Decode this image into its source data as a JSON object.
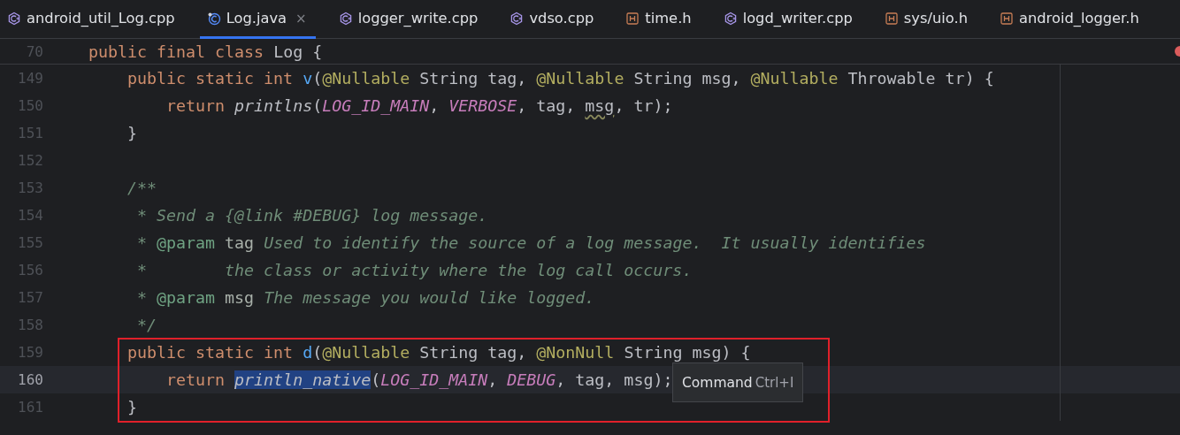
{
  "tabs": [
    {
      "label": "android_util_Log.cpp",
      "kind": "cpp",
      "selected": false
    },
    {
      "label": "Log.java",
      "kind": "java",
      "selected": true,
      "close": "×"
    },
    {
      "label": "logger_write.cpp",
      "kind": "cpp",
      "selected": false
    },
    {
      "label": "vdso.cpp",
      "kind": "cpp",
      "selected": false
    },
    {
      "label": "time.h",
      "kind": "header",
      "selected": false
    },
    {
      "label": "logd_writer.cpp",
      "kind": "cpp",
      "selected": false
    },
    {
      "label": "sys/uio.h",
      "kind": "header",
      "selected": false
    },
    {
      "label": "android_logger.h",
      "kind": "header",
      "selected": false
    }
  ],
  "sticky_line": {
    "number": "70",
    "has_error": true,
    "tokens": [
      {
        "kind": "kw",
        "text": "public final class "
      },
      {
        "kind": "plain",
        "text": "Log {"
      }
    ]
  },
  "lines": [
    {
      "number": "149",
      "current": false,
      "boxed": false,
      "tokens": [
        {
          "kind": "kw",
          "text": "    public static int "
        },
        {
          "kind": "fn",
          "text": "v"
        },
        {
          "kind": "plain",
          "text": "("
        },
        {
          "kind": "ann",
          "text": "@Nullable"
        },
        {
          "kind": "plain",
          "text": " String tag, "
        },
        {
          "kind": "ann",
          "text": "@Nullable"
        },
        {
          "kind": "plain",
          "text": " String msg, "
        },
        {
          "kind": "ann",
          "text": "@Nullable"
        },
        {
          "kind": "plain",
          "text": " Throwable tr) {"
        }
      ]
    },
    {
      "number": "150",
      "current": false,
      "boxed": false,
      "tokens": [
        {
          "kind": "kw",
          "text": "        return "
        },
        {
          "kind": "call",
          "text": "printlns"
        },
        {
          "kind": "plain",
          "text": "("
        },
        {
          "kind": "const",
          "text": "LOG_ID_MAIN"
        },
        {
          "kind": "plain",
          "text": ", "
        },
        {
          "kind": "const",
          "text": "VERBOSE"
        },
        {
          "kind": "plain",
          "text": ", tag, "
        },
        {
          "kind": "typo",
          "text": "msg"
        },
        {
          "kind": "plain",
          "text": ", tr);"
        }
      ]
    },
    {
      "number": "151",
      "current": false,
      "boxed": false,
      "tokens": [
        {
          "kind": "plain",
          "text": "    }"
        }
      ]
    },
    {
      "number": "152",
      "current": false,
      "boxed": false
    },
    {
      "number": "153",
      "current": false,
      "boxed": false,
      "tokens": [
        {
          "kind": "comment",
          "text": "    /**"
        }
      ]
    },
    {
      "number": "154",
      "current": false,
      "boxed": false,
      "tokens": [
        {
          "kind": "comment",
          "text": "     * Send a {@link #DEBUG} log message."
        }
      ]
    },
    {
      "number": "155",
      "current": false,
      "boxed": false,
      "tokens": [
        {
          "kind": "comment",
          "text": "     * "
        },
        {
          "kind": "doctag",
          "text": "@param"
        },
        {
          "kind": "docparam",
          "text": " tag"
        },
        {
          "kind": "comment",
          "text": " Used to identify the source of a log message.  It usually identifies"
        }
      ]
    },
    {
      "number": "156",
      "current": false,
      "boxed": false,
      "tokens": [
        {
          "kind": "comment",
          "text": "     *        the class or activity where the log call occurs."
        }
      ]
    },
    {
      "number": "157",
      "current": false,
      "boxed": false,
      "tokens": [
        {
          "kind": "comment",
          "text": "     * "
        },
        {
          "kind": "doctag",
          "text": "@param"
        },
        {
          "kind": "docparam",
          "text": " msg"
        },
        {
          "kind": "comment",
          "text": " The message you would like logged."
        }
      ]
    },
    {
      "number": "158",
      "current": false,
      "boxed": false,
      "tokens": [
        {
          "kind": "comment",
          "text": "     */"
        }
      ]
    },
    {
      "number": "159",
      "current": false,
      "boxed": true,
      "tokens": [
        {
          "kind": "kw",
          "text": "    public static int "
        },
        {
          "kind": "fn",
          "text": "d"
        },
        {
          "kind": "plain",
          "text": "("
        },
        {
          "kind": "ann",
          "text": "@Nullable"
        },
        {
          "kind": "plain",
          "text": " String tag, "
        },
        {
          "kind": "ann",
          "text": "@NonNull"
        },
        {
          "kind": "plain",
          "text": " String msg) {"
        }
      ]
    },
    {
      "number": "160",
      "current": true,
      "boxed": true,
      "tokens": [
        {
          "kind": "kw",
          "text": "        return "
        },
        {
          "kind": "selected",
          "text": "println_native"
        },
        {
          "kind": "plain",
          "text": "("
        },
        {
          "kind": "const",
          "text": "LOG_ID_MAIN"
        },
        {
          "kind": "plain",
          "text": ", "
        },
        {
          "kind": "const",
          "text": "DEBUG"
        },
        {
          "kind": "plain",
          "text": ", tag, msg);"
        }
      ],
      "tooltip": {
        "label": "Command",
        "shortcut": "Ctrl+I"
      }
    },
    {
      "number": "161",
      "current": false,
      "boxed": true,
      "tokens": [
        {
          "kind": "plain",
          "text": "    }"
        }
      ]
    }
  ]
}
